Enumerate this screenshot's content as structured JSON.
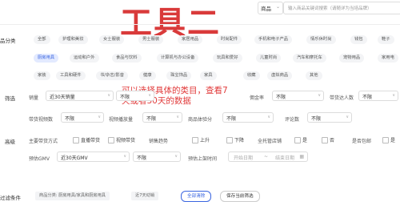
{
  "overlay": {
    "big_title": "工具二",
    "annotation": "可以选择具体的类目，查看7天或者30天的数据"
  },
  "search": {
    "type_label": "商品",
    "placeholder": "输入商品关键词搜索（请随详为当培品牌）"
  },
  "category": {
    "label": "品分类",
    "row1": [
      "全部",
      "护理和美妆",
      "女士服装",
      "男士服装",
      "家居用品",
      "时尚配件",
      "手机和电子产品",
      "情乐休时尚",
      "钱包",
      "鞋子"
    ],
    "row2": [
      "厨房用具",
      "运动和户外",
      "食品与饮料",
      "计算机与办公设备",
      "玩具和爱好",
      "儿童时尚",
      "汽车和摩托车",
      "宠物用品",
      "家用电"
    ],
    "row3": [
      "家装",
      "工具和硬件",
      "书/杂志/影音",
      "健康",
      "珠宝饰品",
      "家具",
      "收藏",
      "虚拟商品",
      "其他"
    ]
  },
  "filter": {
    "label": "筛选",
    "sales_label": "销量",
    "sales_value": "近30天销量",
    "unlimited": "不限",
    "unit_label": "佣金率",
    "commission_value": "不限",
    "influencer_label": "带货达人数",
    "influencer_value": "不限",
    "video_count_label": "带货视频数",
    "video_count_value": "不限",
    "video_play_label": "视频播放量",
    "video_play_value": "不限",
    "rating_label": "商品体验分",
    "rating_value": "不限",
    "review_label": "评论数",
    "review_value": "不限"
  },
  "advanced": {
    "label": "高级",
    "channel_label": "主要带货方式",
    "live_label": "直播带货",
    "video_label": "视频带货",
    "trend_label": "销售趋势",
    "up_label": "上升",
    "down_label": "下降",
    "fba_label": "全托管店铺",
    "yes_label": "是",
    "no_label": "否",
    "free_ship_label": "是否包邮",
    "free_ship_yes": "是",
    "gmv_label": "预估GMV",
    "gmv_value": "近30天GMV",
    "gmv_range": "不限",
    "time_label": "预估上架时间",
    "start_placeholder": "开始日期",
    "separator": "~",
    "end_placeholder": "结束日期"
  },
  "conditions": {
    "label": "过滤条件",
    "tags": [
      "商品分类: 厨房用具/家具和厨房用具",
      "近7天动销"
    ],
    "clear_label": "全部清除",
    "save_label": "保存当前筛选"
  }
}
